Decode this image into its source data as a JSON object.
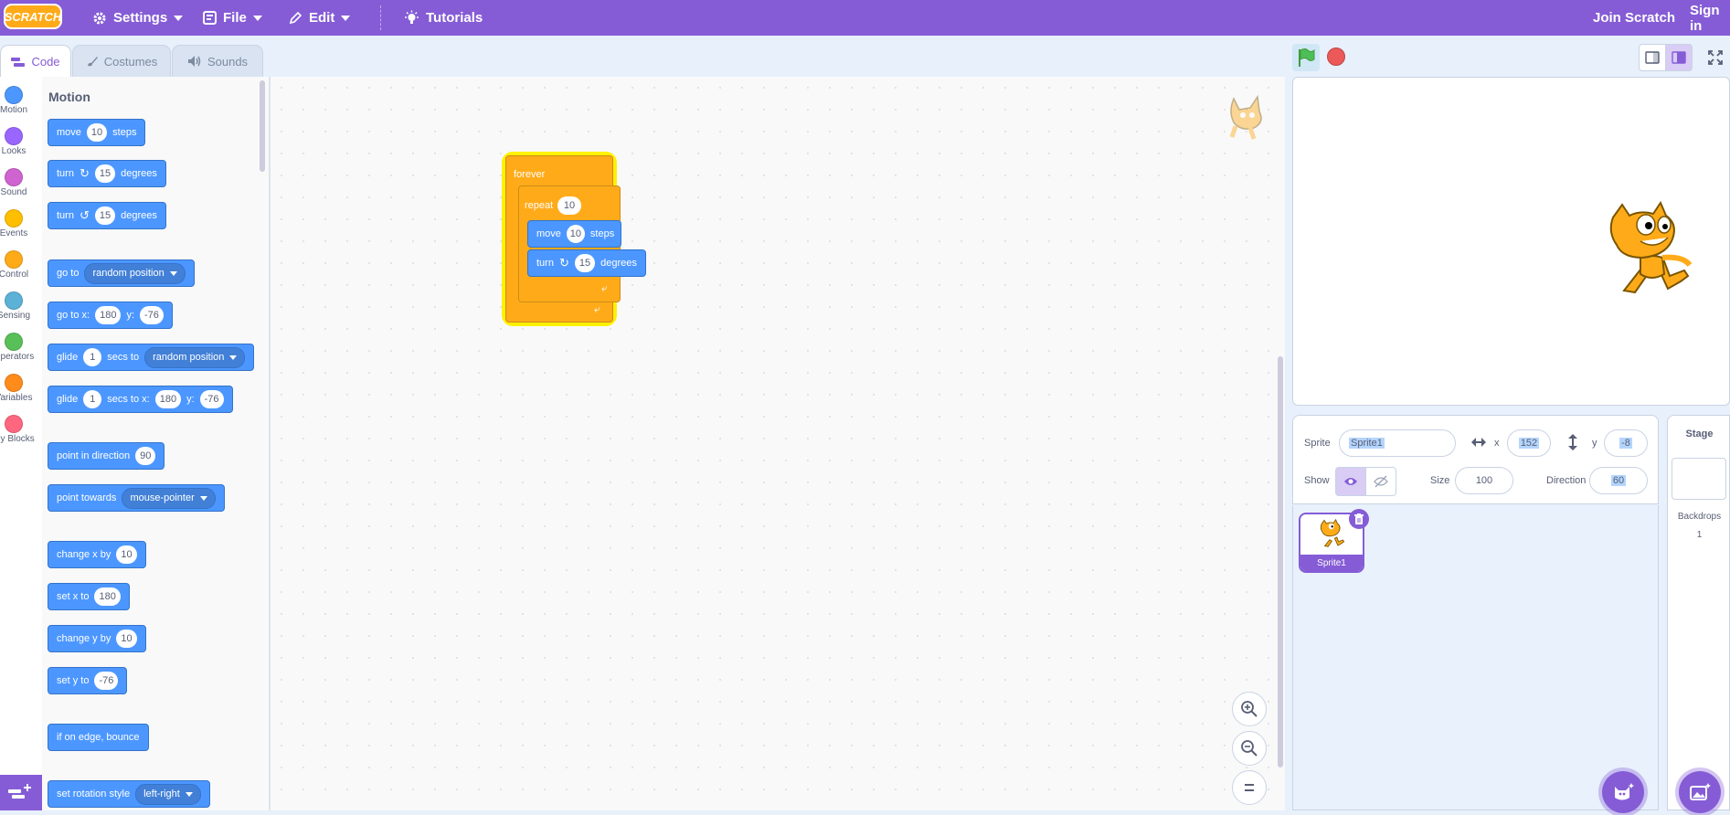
{
  "menubar": {
    "logo": "SCRATCH",
    "settings": "Settings",
    "file": "File",
    "edit": "Edit",
    "tutorials": "Tutorials",
    "join": "Join Scratch",
    "signin": "Sign in",
    "bar_color": "#855cd6"
  },
  "tabs": [
    {
      "label": "Code",
      "active": true
    },
    {
      "label": "Costumes",
      "active": false
    },
    {
      "label": "Sounds",
      "active": false
    }
  ],
  "categories": [
    {
      "label": "Motion",
      "color": "#4c97ff"
    },
    {
      "label": "Looks",
      "color": "#9966ff"
    },
    {
      "label": "Sound",
      "color": "#cf63cf"
    },
    {
      "label": "Events",
      "color": "#ffbf00"
    },
    {
      "label": "Control",
      "color": "#ffab19"
    },
    {
      "label": "Sensing",
      "color": "#5cb1d6"
    },
    {
      "label": "Operators",
      "color": "#59c059"
    },
    {
      "label": "Variables",
      "color": "#ff8c1a"
    },
    {
      "label": "My Blocks",
      "color": "#ff6680"
    }
  ],
  "palette": {
    "heading": "Motion",
    "blocks": {
      "move": {
        "a": "move",
        "n": "10",
        "b": "steps"
      },
      "turn_right": {
        "a": "turn",
        "n": "15",
        "b": "degrees"
      },
      "turn_left": {
        "a": "turn",
        "n": "15",
        "b": "degrees"
      },
      "goto": {
        "a": "go to",
        "dd": "random position"
      },
      "goto_xy": {
        "a": "go to x:",
        "x": "180",
        "b": "y:",
        "y": "-76"
      },
      "glide_to": {
        "a": "glide",
        "n": "1",
        "b": "secs to",
        "dd": "random position"
      },
      "glide_xy": {
        "a": "glide",
        "n": "1",
        "b": "secs to x:",
        "x": "180",
        "c": "y:",
        "y": "-76"
      },
      "point_dir": {
        "a": "point in direction",
        "n": "90"
      },
      "point_towards": {
        "a": "point towards",
        "dd": "mouse-pointer"
      },
      "change_x": {
        "a": "change x by",
        "n": "10"
      },
      "set_x": {
        "a": "set x to",
        "n": "180"
      },
      "change_y": {
        "a": "change y by",
        "n": "10"
      },
      "set_y": {
        "a": "set y to",
        "n": "-76"
      },
      "bounce": {
        "a": "if on edge, bounce"
      },
      "rotation_style": {
        "a": "set rotation style",
        "dd": "left-right"
      }
    }
  },
  "script": {
    "forever": "forever",
    "repeat": "repeat",
    "repeat_n": "10",
    "move": "move",
    "move_n": "10",
    "steps": "steps",
    "turn": "turn",
    "turn_n": "15",
    "degrees": "degrees"
  },
  "sprite_info": {
    "sprite_label": "Sprite",
    "sprite_name": "Sprite1",
    "x_label": "x",
    "x_value": "152",
    "y_label": "y",
    "y_value": "-8",
    "show_label": "Show",
    "size_label": "Size",
    "size_value": "100",
    "direction_label": "Direction",
    "direction_value": "60"
  },
  "sprite_list": [
    {
      "name": "Sprite1",
      "selected": true
    }
  ],
  "stage_pane": {
    "title": "Stage",
    "backdrops_label": "Backdrops",
    "backdrops_count": "1"
  },
  "icons": [
    "gear-icon",
    "file-icon",
    "pencil-icon",
    "lightbulb-icon",
    "green-flag-icon",
    "stop-icon",
    "small-stage-icon",
    "large-stage-icon",
    "fullscreen-icon",
    "zoom-in-icon",
    "zoom-out-icon",
    "zoom-reset-icon",
    "eye-icon",
    "eye-off-icon",
    "trash-icon",
    "choose-sprite-icon",
    "choose-backdrop-icon",
    "add-extension-icon"
  ]
}
